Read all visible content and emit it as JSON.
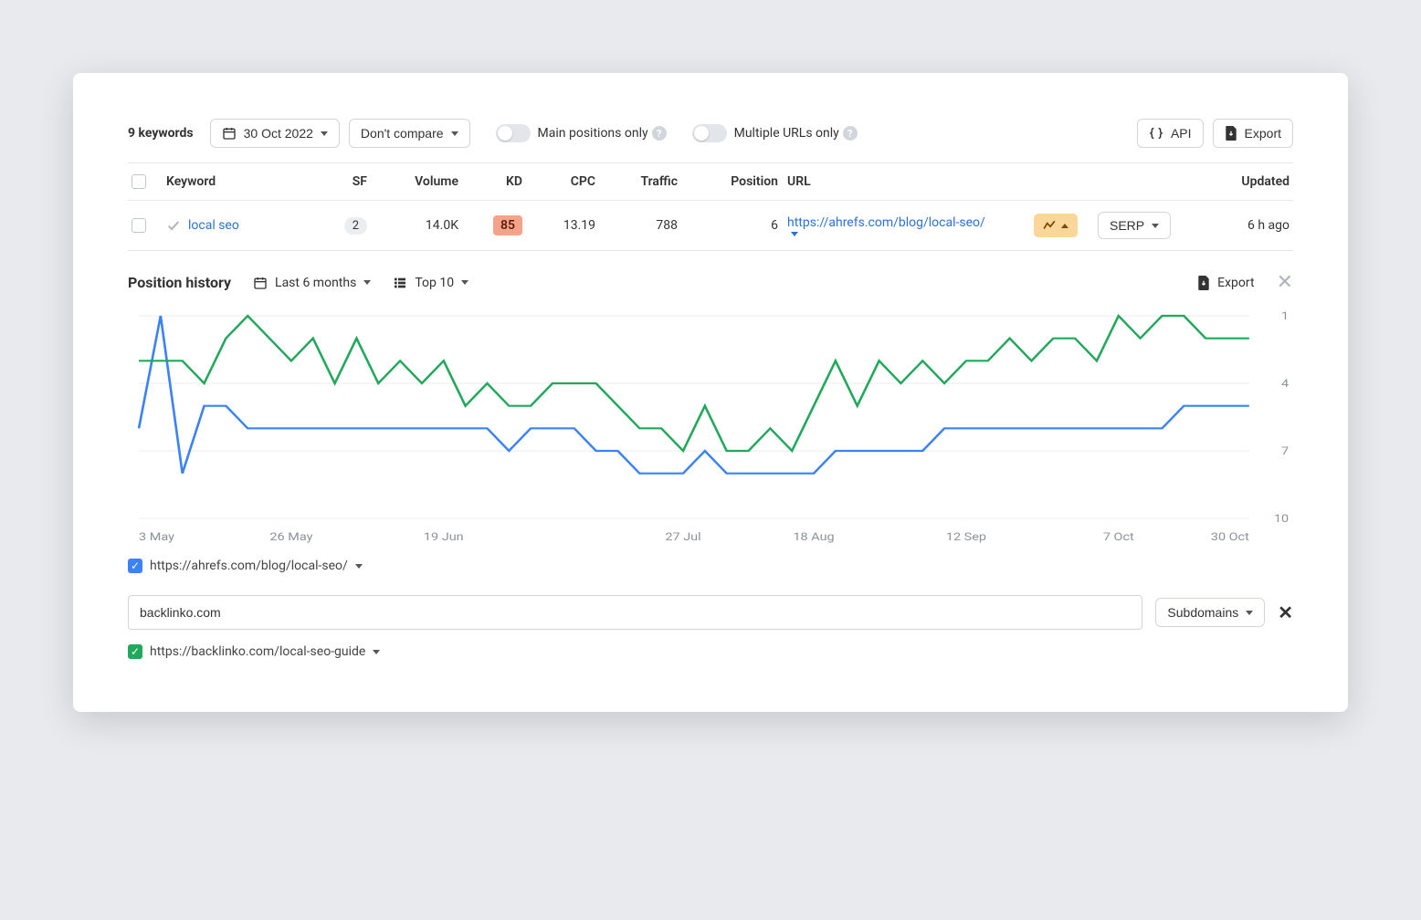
{
  "toolbar": {
    "keywords_count": "9 keywords",
    "date": "30 Oct 2022",
    "compare": "Don't compare",
    "main_positions_label": "Main positions only",
    "multiple_urls_label": "Multiple URLs only",
    "api_label": "API",
    "export_label": "Export"
  },
  "table": {
    "headers": {
      "keyword": "Keyword",
      "sf": "SF",
      "volume": "Volume",
      "kd": "KD",
      "cpc": "CPC",
      "traffic": "Traffic",
      "position": "Position",
      "url": "URL",
      "updated": "Updated"
    },
    "rows": [
      {
        "keyword": "local seo",
        "sf": "2",
        "volume": "14.0K",
        "kd": "85",
        "cpc": "13.19",
        "traffic": "788",
        "position": "6",
        "url": "https://ahrefs.com/blog/local-seo/",
        "serp_label": "SERP",
        "updated": "6 h ago"
      }
    ]
  },
  "history": {
    "title": "Position history",
    "range": "Last 6 months",
    "top": "Top 10",
    "export_label": "Export"
  },
  "chart_data": {
    "type": "line",
    "ylabel": "Position",
    "ylim": [
      10,
      1
    ],
    "x_ticks": [
      "3 May",
      "26 May",
      "19 Jun",
      "27 Jul",
      "18 Aug",
      "12 Sep",
      "7 Oct",
      "30 Oct"
    ],
    "y_ticks": [
      "1",
      "4",
      "7",
      "10"
    ],
    "series": [
      {
        "name": "https://ahrefs.com/blog/local-seo/",
        "color": "#3b82f6",
        "x": [
          0,
          1,
          2,
          3,
          4,
          5,
          6,
          7,
          8,
          9,
          10,
          11,
          12,
          13,
          14,
          15,
          16,
          17,
          18,
          19,
          20,
          21,
          22,
          23,
          24,
          25,
          26,
          27,
          28,
          29,
          30,
          31,
          32,
          33,
          34,
          35,
          36,
          37,
          38,
          39,
          40,
          41,
          42,
          43,
          44,
          45,
          46,
          47,
          48,
          49,
          50,
          51
        ],
        "y": [
          6,
          1,
          8,
          5,
          5,
          6,
          6,
          6,
          6,
          6,
          6,
          6,
          6,
          6,
          6,
          6,
          6,
          7,
          6,
          6,
          6,
          7,
          7,
          8,
          8,
          8,
          7,
          8,
          8,
          8,
          8,
          8,
          7,
          7,
          7,
          7,
          7,
          6,
          6,
          6,
          6,
          6,
          6,
          6,
          6,
          6,
          6,
          6,
          5,
          5,
          5,
          5
        ]
      },
      {
        "name": "https://backlinko.com/local-seo-guide",
        "color": "#22a85a",
        "x": [
          0,
          1,
          2,
          3,
          4,
          5,
          6,
          7,
          8,
          9,
          10,
          11,
          12,
          13,
          14,
          15,
          16,
          17,
          18,
          19,
          20,
          21,
          22,
          23,
          24,
          25,
          26,
          27,
          28,
          29,
          30,
          31,
          32,
          33,
          34,
          35,
          36,
          37,
          38,
          39,
          40,
          41,
          42,
          43,
          44,
          45,
          46,
          47,
          48,
          49,
          50,
          51
        ],
        "y": [
          3,
          3,
          3,
          4,
          2,
          1,
          2,
          3,
          2,
          4,
          2,
          4,
          3,
          4,
          3,
          5,
          4,
          5,
          5,
          4,
          4,
          4,
          5,
          6,
          6,
          7,
          5,
          7,
          7,
          6,
          7,
          5,
          3,
          5,
          3,
          4,
          3,
          4,
          3,
          3,
          2,
          3,
          2,
          2,
          3,
          1,
          2,
          1,
          1,
          2,
          2,
          2
        ]
      }
    ]
  },
  "legend": {
    "series1": "https://ahrefs.com/blog/local-seo/",
    "series2": "https://backlinko.com/local-seo-guide"
  },
  "competitor": {
    "input_value": "backlinko.com",
    "scope": "Subdomains"
  }
}
